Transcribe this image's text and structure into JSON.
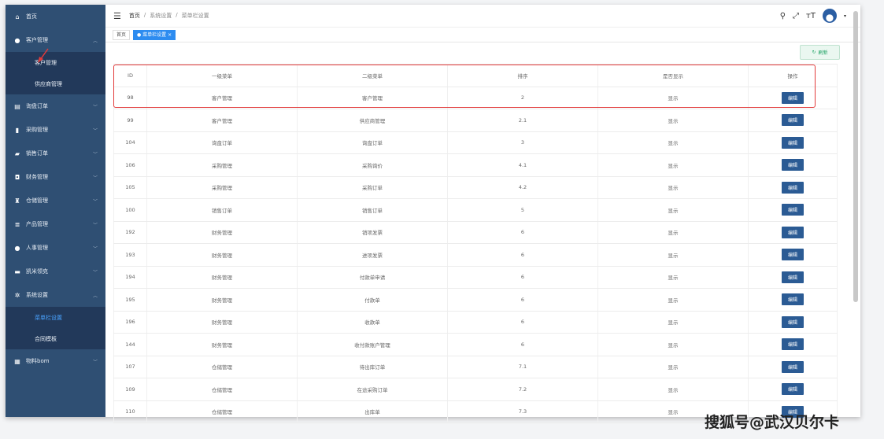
{
  "sidebar": {
    "home": "首页",
    "customer": "客户管理",
    "customer_sub": [
      "客户管理",
      "供应商管理"
    ],
    "groups": [
      "询盘订单",
      "采购管理",
      "销售订单",
      "财务管理",
      "仓储管理",
      "产品管理",
      "人事管理",
      "凯米领克"
    ],
    "system": "系统设置",
    "system_sub": [
      "菜单栏设置",
      "合同模板"
    ],
    "bom": "物料bom"
  },
  "breadcrumb": [
    "首页",
    "/",
    "系统设置",
    "/",
    "菜单栏设置"
  ],
  "tags": {
    "home": "首页",
    "active": "● 菜单栏设置 ×"
  },
  "refresh_label": "刷新",
  "table": {
    "headers": [
      "ID",
      "一级菜单",
      "二级菜单",
      "排序",
      "是否显示",
      "操作"
    ],
    "action_label": "编辑",
    "rows": [
      [
        "98",
        "客户管理",
        "客户管理",
        "2",
        "显示"
      ],
      [
        "99",
        "客户管理",
        "供应商管理",
        "2.1",
        "显示"
      ],
      [
        "104",
        "询盘订单",
        "询盘订单",
        "3",
        "显示"
      ],
      [
        "106",
        "采购管理",
        "采购询价",
        "4.1",
        "显示"
      ],
      [
        "105",
        "采购管理",
        "采购订单",
        "4.2",
        "显示"
      ],
      [
        "100",
        "销售订单",
        "销售订单",
        "5",
        "显示"
      ],
      [
        "192",
        "财务管理",
        "销项发票",
        "6",
        "显示"
      ],
      [
        "193",
        "财务管理",
        "进项发票",
        "6",
        "显示"
      ],
      [
        "194",
        "财务管理",
        "付款单申请",
        "6",
        "显示"
      ],
      [
        "195",
        "财务管理",
        "付款单",
        "6",
        "显示"
      ],
      [
        "196",
        "财务管理",
        "收款单",
        "6",
        "显示"
      ],
      [
        "144",
        "财务管理",
        "收付款账户管理",
        "6",
        "显示"
      ],
      [
        "107",
        "仓储管理",
        "待出库订单",
        "7.1",
        "显示"
      ],
      [
        "109",
        "仓储管理",
        "在途采购订单",
        "7.2",
        "显示"
      ],
      [
        "110",
        "仓储管理",
        "出库单",
        "7.3",
        "显示"
      ]
    ]
  },
  "watermark": "搜狐号@武汉贝尔卡",
  "colors": {
    "sidebar": "#2f4f73",
    "accent": "#2b5b94",
    "highlight": "#e23b3b"
  }
}
